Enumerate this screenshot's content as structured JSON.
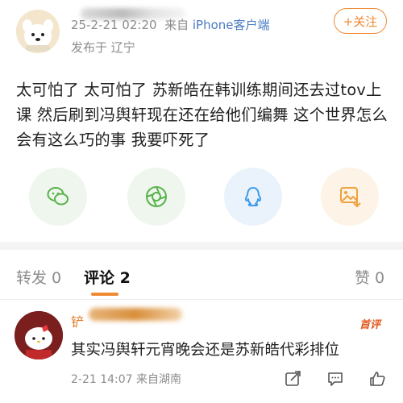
{
  "post": {
    "meta_date": "25-2-21 02:20",
    "meta_from": "来自",
    "meta_source": "iPhone客户端",
    "location": "发布于 辽宁",
    "follow_label": "+关注",
    "text": "太可怕了 太可怕了 苏新皓在韩训练期间还去过tov上课 然后刷到冯舆轩现在还在给他们编舞 这个世界怎么会有这么巧的事 我要吓死了"
  },
  "share": [
    {
      "icon": "wechat-icon",
      "bg": "#eef6ee",
      "color": "#58b34a"
    },
    {
      "icon": "moments-icon",
      "bg": "#eef6ee",
      "color": "#58b34a"
    },
    {
      "icon": "qq-icon",
      "bg": "#eaf3fb",
      "color": "#3d9be9"
    },
    {
      "icon": "save-image-icon",
      "bg": "#fdf3e6",
      "color": "#f0a13a"
    }
  ],
  "tabs": {
    "repost": "转发 0",
    "comments": "评论 2",
    "likes": "赞 0"
  },
  "comment": {
    "name_prefix": "铲",
    "badge": "首评",
    "text": "其实冯舆轩元宵晚会还是苏新皓代彩排位",
    "meta": "2-21 14:07 来自湖南"
  },
  "colors": {
    "accent": "#f08a33",
    "link": "#4a7bc2"
  }
}
